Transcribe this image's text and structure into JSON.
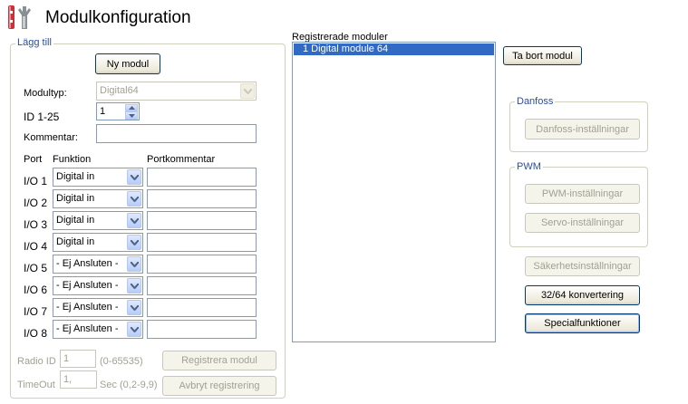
{
  "title": "Modulkonfiguration",
  "add_group": {
    "label": "Lägg till",
    "new_module_button": "Ny modul",
    "module_type_label": "Modultyp:",
    "module_type_value": "Digital64",
    "id_label": "ID  1-25",
    "id_value": "1",
    "comment_label": "Kommentar:",
    "comment_value": "",
    "col_port": "Port",
    "col_function": "Funktion",
    "col_port_comment": "Portkommentar",
    "ports": [
      {
        "label": "I/O 1",
        "function": "Digital in",
        "comment": ""
      },
      {
        "label": "I/O 2",
        "function": "Digital in",
        "comment": ""
      },
      {
        "label": "I/O 3",
        "function": "Digital in",
        "comment": ""
      },
      {
        "label": "I/O 4",
        "function": "Digital in",
        "comment": ""
      },
      {
        "label": "I/O 5",
        "function": "- Ej Ansluten -",
        "comment": ""
      },
      {
        "label": "I/O 6",
        "function": "- Ej Ansluten -",
        "comment": ""
      },
      {
        "label": "I/O 7",
        "function": "- Ej Ansluten -",
        "comment": ""
      },
      {
        "label": "I/O 8",
        "function": "- Ej Ansluten -",
        "comment": ""
      }
    ],
    "radio_id_label": "Radio ID",
    "radio_id_value": "1",
    "radio_id_range": "(0-65535)",
    "timeout_label": "TimeOut",
    "timeout_value": "1,",
    "timeout_range": "Sec (0,2-9,9)",
    "register_button": "Registrera modul",
    "cancel_button": "Avbryt registrering"
  },
  "registered": {
    "label": "Registrerade moduler",
    "items": [
      "1  Digital module 64"
    ]
  },
  "remove_button": "Ta bort modul",
  "danfoss_group": {
    "label": "Danfoss",
    "settings_button": "Danfoss-inställningar"
  },
  "pwm_group": {
    "label": "PWM",
    "pwm_button": "PWM-inställningar",
    "servo_button": "Servo-inställningar"
  },
  "safety_button": "Säkerhetsinställningar",
  "convert_button": "32/64 konvertering",
  "special_button": "Specialfunktioner",
  "colors": {
    "selection": "#316ac5",
    "groupbox_label_blue": "#2b4ca0",
    "button_border": "#003c74",
    "disabled_text": "#a1a192"
  }
}
